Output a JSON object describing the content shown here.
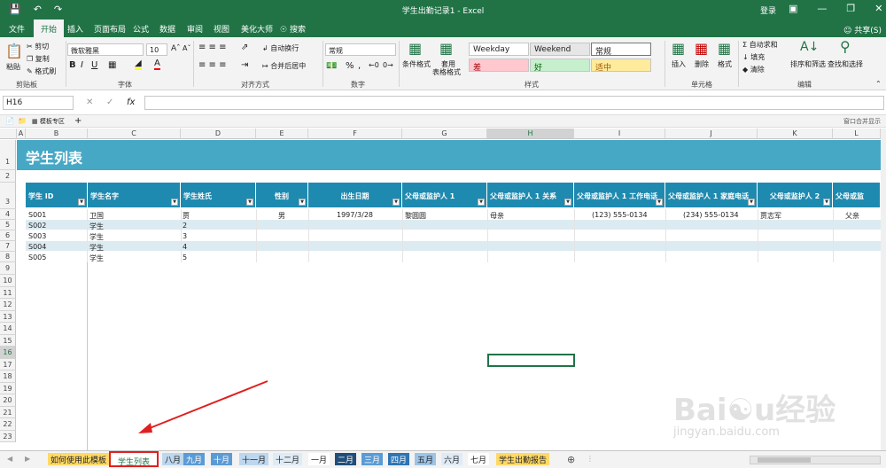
{
  "titlebar": {
    "doc_title": "学生出勤记录1 - Excel",
    "login": "登录",
    "save_icon": "save-icon",
    "undo_icon": "undo-icon",
    "redo_icon": "redo-icon"
  },
  "tabs": [
    "文件",
    "开始",
    "插入",
    "页面布局",
    "公式",
    "数据",
    "审阅",
    "视图",
    "美化大师",
    "搜索"
  ],
  "share": "共享(S)",
  "clipboard": {
    "paste": "粘贴",
    "cut": "剪切",
    "copy": "复制",
    "format_painter": "格式刷",
    "label": "剪贴板"
  },
  "font": {
    "name": "微软雅黑",
    "size": "10",
    "label": "字体",
    "bold": "B",
    "italic": "I",
    "underline": "U",
    "font_color_glyph": "A"
  },
  "alignment": {
    "wrap": "自动换行",
    "merge": "合并后居中",
    "label": "对齐方式"
  },
  "number": {
    "format": "常规",
    "label": "数字",
    "percent": "%",
    "comma": ","
  },
  "styles": {
    "conditional": "条件格式",
    "table_format_1": "套用",
    "table_format_2": "表格格式",
    "weekday": "Weekday",
    "weekend": "Weekend",
    "normal": "常规",
    "bad": "差",
    "good": "好",
    "neutral": "适中",
    "label": "样式"
  },
  "cells_group": {
    "insert": "插入",
    "delete": "删除",
    "format": "格式",
    "label": "单元格"
  },
  "editing": {
    "autosum": "自动求和",
    "fill": "填充",
    "clear": "清除",
    "sort": "排序和筛选",
    "find": "查找和选择",
    "label": "编辑"
  },
  "formula_bar": {
    "name_box": "H16",
    "cancel": "✕",
    "enter": "✓",
    "fx": "fx",
    "value": ""
  },
  "workbook_bar": {
    "tab_label": "模板专区",
    "right_text": "窗口合并显示"
  },
  "columns": [
    "A",
    "B",
    "C",
    "D",
    "E",
    "F",
    "G",
    "H",
    "I",
    "J",
    "K",
    "L"
  ],
  "rows": [
    "1",
    "2",
    "3",
    "4",
    "5",
    "6",
    "7",
    "8",
    "9",
    "10",
    "11",
    "12",
    "13",
    "14",
    "15",
    "16",
    "17",
    "18",
    "19",
    "20",
    "21",
    "22",
    "23"
  ],
  "sheet_title": "学生列表",
  "table_headers": [
    "学生 ID",
    "学生名字",
    "学生姓氏",
    "性别",
    "出生日期",
    "父母或监护人 1",
    "父母或监护人 1 关系",
    "父母或监护人 1 工作电话",
    "父母或监护人 1 家庭电话",
    "父母或监护人 2",
    "父母或监"
  ],
  "table_rows": [
    [
      "S001",
      "卫国",
      "贾",
      "男",
      "1997/3/28",
      "黎圆圆",
      "母亲",
      "(123) 555-0134",
      "(234) 555-0134",
      "贾志军",
      "父亲"
    ],
    [
      "S002",
      "学生",
      "2",
      "",
      "",
      "",
      "",
      "",
      "",
      "",
      ""
    ],
    [
      "S003",
      "学生",
      "3",
      "",
      "",
      "",
      "",
      "",
      "",
      "",
      ""
    ],
    [
      "S004",
      "学生",
      "4",
      "",
      "",
      "",
      "",
      "",
      "",
      "",
      ""
    ],
    [
      "S005",
      "学生",
      "5",
      "",
      "",
      "",
      "",
      "",
      "",
      "",
      ""
    ]
  ],
  "sheet_tabs": [
    "如何使用此模板",
    "学生列表",
    "八月",
    "九月",
    "十月",
    "十一月",
    "十二月",
    "一月",
    "二月",
    "三月",
    "四月",
    "五月",
    "六月",
    "七月",
    "学生出勤报告"
  ],
  "active_sheet": "学生列表",
  "colors": {
    "excel_green": "#217346",
    "title_band": "#47a8c5",
    "header_fill": "#1f8aaf",
    "row_band": "#dcebf1"
  },
  "watermark": "Baidu经验 jingyan.baidu.com"
}
